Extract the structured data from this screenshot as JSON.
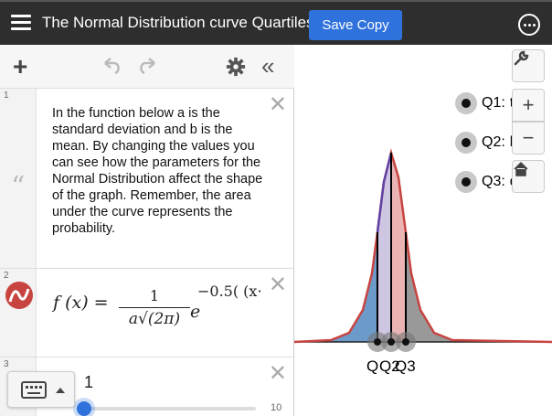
{
  "header": {
    "title": "The Normal Distribution curve Quartiles",
    "save_label": "Save Copy"
  },
  "expressions": {
    "note": {
      "index": "1",
      "text": "In the function below a is the standard deviation and b is the mean. By changing the values you can see how the parameters for the Normal Distribution affect the shape of the graph. Remember, the area under the curve represents the probability."
    },
    "formula": {
      "index": "2",
      "lhs": "f (x) =",
      "numerator": "1",
      "denominator": "a√(2π)",
      "e": "e",
      "exponent": "−0.5( (x·"
    },
    "slider": {
      "index": "3",
      "value": "1",
      "max_label": "10",
      "level": 0.0
    }
  },
  "graph": {
    "legend": [
      {
        "label": "Q1:",
        "tail": "t"
      },
      {
        "label": "Q2:",
        "tail": "b"
      },
      {
        "label": "Q3:",
        "tail": "d"
      }
    ],
    "quartile_labels": [
      "Q",
      "Q2",
      "Q3"
    ],
    "colors": {
      "curve": "#c74440",
      "region_left": "#2d70b3",
      "region_q1q2": "#6042a6",
      "region_q2q3": "#c74440",
      "region_right": "#666666"
    }
  },
  "icons": {
    "menu": "hamburger-icon",
    "add": "plus-icon",
    "undo": "undo-icon",
    "redo": "redo-icon",
    "settings": "gear-icon",
    "collapse": "double-chevron-left-icon",
    "wrench": "wrench-icon",
    "zoom_in": "plus-icon",
    "zoom_out": "minus-icon",
    "home": "home-icon",
    "more": "ellipsis-circle-icon",
    "keyboard": "keyboard-icon"
  }
}
